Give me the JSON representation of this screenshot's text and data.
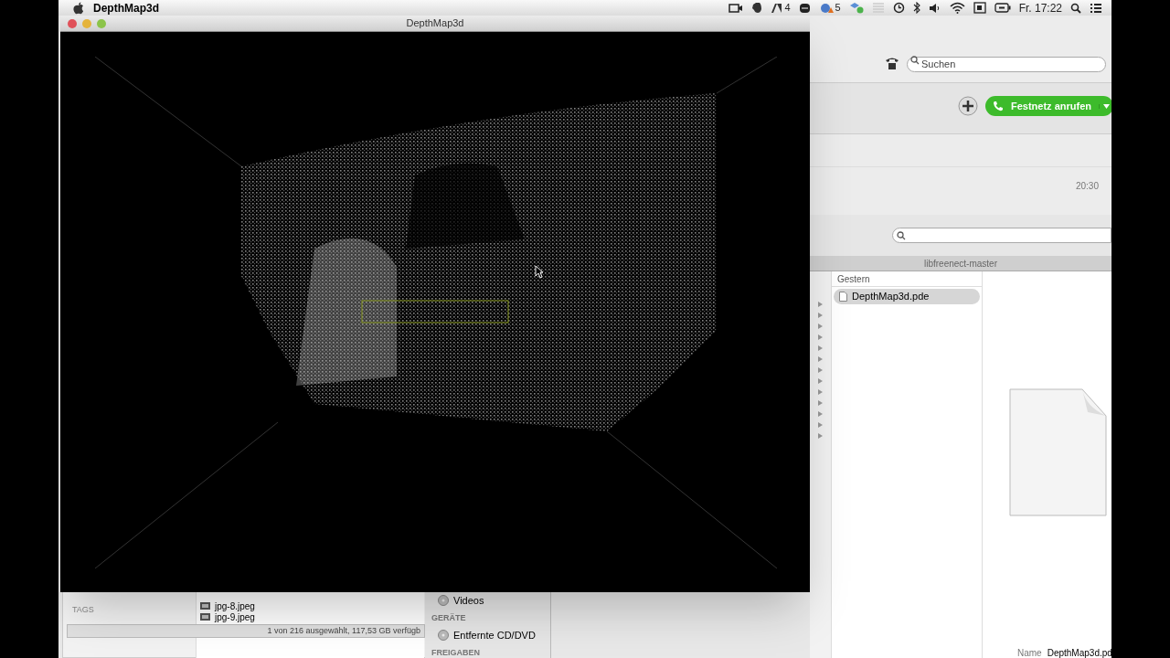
{
  "menu_bar": {
    "app_name": "DepthMap3d",
    "adobe_count": "4",
    "cloud_count": "5",
    "clock": "Fr. 17:22"
  },
  "main_window": {
    "title": "DepthMap3d"
  },
  "phone_window": {
    "search": {
      "placeholder": "Suchen"
    },
    "call_button": "Festnetz anrufen",
    "calls": [
      {
        "time": "20:30"
      }
    ]
  },
  "finder_window": {
    "title": "libfreenect-master",
    "column_header": "Gestern",
    "files": [
      {
        "name": "DepthMap3d.pde",
        "selected": true
      }
    ],
    "preview": {
      "name_label": "Name",
      "name_value": "DepthMap3d.pd"
    }
  },
  "finder_window_bottom": {
    "sidebar_header": "TAGS",
    "files": [
      "jpg-8.jpeg",
      "jpg-9.jpeg"
    ],
    "status": "1 von 216 ausgewählt, 117,53 GB verfügb"
  },
  "sidebar_window": {
    "items": [
      {
        "kind": "item",
        "label": "Videos"
      },
      {
        "kind": "header",
        "label": "GERÄTE"
      },
      {
        "kind": "item",
        "label": "Entfernte CD/DVD"
      },
      {
        "kind": "header",
        "label": "FREIGABEN"
      }
    ]
  }
}
